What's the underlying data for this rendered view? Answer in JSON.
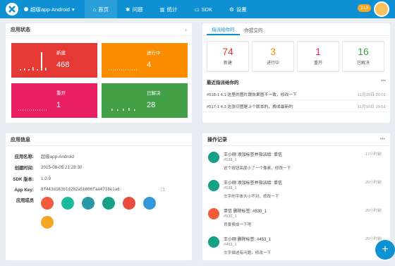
{
  "nav": {
    "app_name": "超级app-Android",
    "items": [
      {
        "label": "首页",
        "icon": "home-icon"
      },
      {
        "label": "问题",
        "icon": "bug-icon"
      },
      {
        "label": "统计",
        "icon": "chart-icon"
      },
      {
        "label": "SDK",
        "icon": "sdk-icon"
      },
      {
        "label": "设置",
        "icon": "gear-icon"
      }
    ],
    "badge": "213"
  },
  "status_panel": {
    "title": "应用状态",
    "tiles": [
      {
        "label": "新建",
        "value": "468",
        "color": "#e53935"
      },
      {
        "label": "进行中",
        "value": "4",
        "color": "#fb8c00"
      },
      {
        "label": "重开",
        "value": "1",
        "color": "#e91e63"
      },
      {
        "label": "已解决",
        "value": "28",
        "color": "#43a047"
      }
    ]
  },
  "assigned_panel": {
    "tabs": [
      "指派给你的",
      "你提交的"
    ],
    "counts": [
      {
        "n": "74",
        "label": "新建",
        "color": "#e53935"
      },
      {
        "n": "3",
        "label": "进行中",
        "color": "#fb8c00"
      },
      {
        "n": "1",
        "label": "重开",
        "color": "#e91e63"
      },
      {
        "n": "16",
        "label": "已解决",
        "color": "#43a047"
      }
    ],
    "recent_title": "最近指派给你的",
    "recent": [
      {
        "text": "#518-1 4.1 这里的图片跟效果图不一致，修改一下",
        "time": "11月10日 20:01"
      },
      {
        "text": "#517-1 4.3 这张切图是上个版本的，换成最新的",
        "time": "11月10日 19:51"
      }
    ]
  },
  "info_panel": {
    "title": "应用信息",
    "rows": [
      {
        "k": "应用名称:",
        "v": "超级app-Android"
      },
      {
        "k": "创建时间:",
        "v": "2015-08-05 21:28:30"
      },
      {
        "k": "SDK 版本:",
        "v": "1.0.9"
      },
      {
        "k": "App Key:",
        "v": "8f443d183b1d202a5b006faa4718e1a6"
      }
    ],
    "members_label": "应用成员"
  },
  "log_panel": {
    "title": "操作记录",
    "items": [
      {
        "l1": "王小刚  添加标签并指派给:  单信",
        "l2": "#538_1",
        "l3": "这个按钮高度小了一个像素，修改一下",
        "time": "17小时前"
      },
      {
        "l1": "王小刚  添加标签并指派给:  单信",
        "l2": "#538_1",
        "l3": "文字的字体大小不对，修改一下",
        "time": "20小时前"
      },
      {
        "l1": "单信  删除标签: #530_1",
        "l2": "#530_1",
        "l3": "背景换成一下吧",
        "time": "20小时前"
      },
      {
        "l1": "王小刚  删除标签: #453_1",
        "l2": "#453_1",
        "l3": "文字描述有问题，修改一下",
        "time": "20小时前"
      }
    ]
  }
}
